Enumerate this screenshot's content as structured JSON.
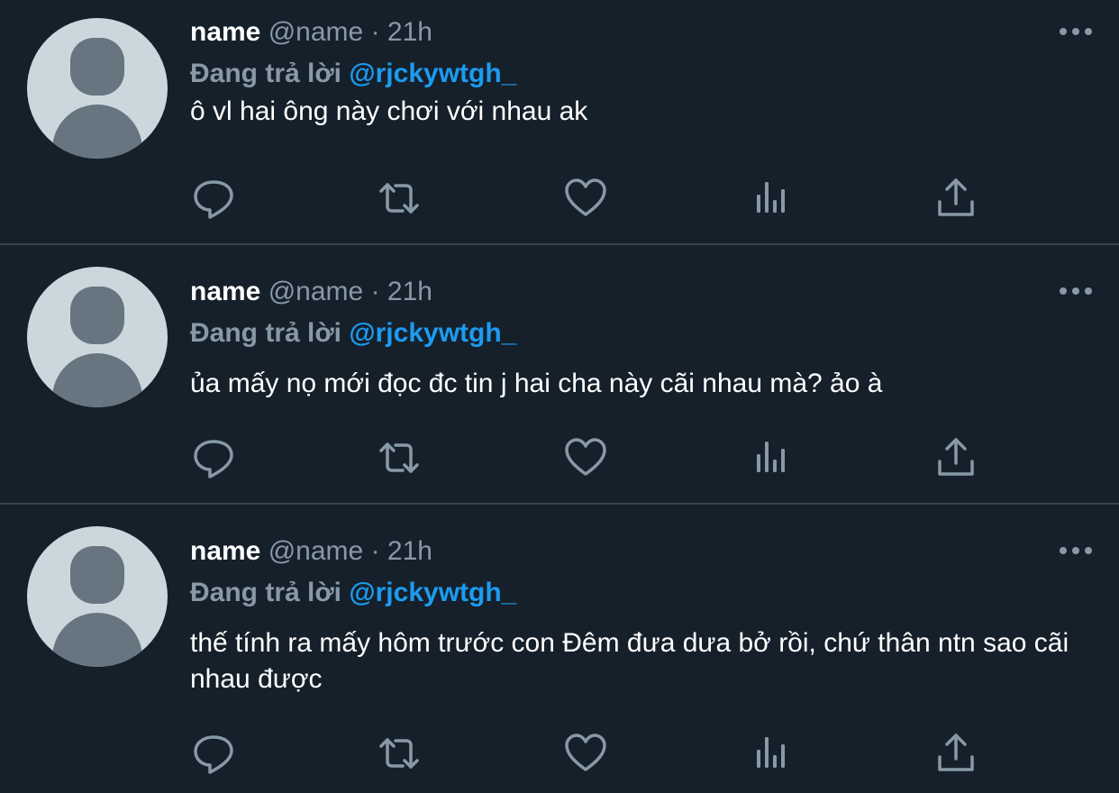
{
  "colors": {
    "background": "#15202b",
    "text": "#ffffff",
    "muted": "#8899a6",
    "link": "#1d9bf0",
    "divider": "#38444d",
    "icon": "#8899a6"
  },
  "tweets": [
    {
      "display_name": "name",
      "handle": "@name",
      "separator": "·",
      "time": "21h",
      "reply_prefix": "Đang trả lời",
      "reply_to": "@rjckywtgh_",
      "text": "ô vl hai ông này chơi với nhau ak"
    },
    {
      "display_name": "name",
      "handle": "@name",
      "separator": "·",
      "time": "21h",
      "reply_prefix": "Đang trả lời",
      "reply_to": "@rjckywtgh_",
      "text": "ủa mấy nọ mới đọc đc tin j hai cha này cãi nhau mà? ảo à"
    },
    {
      "display_name": "name",
      "handle": "@name",
      "separator": "·",
      "time": "21h",
      "reply_prefix": "Đang trả lời",
      "reply_to": "@rjckywtgh_",
      "text": "thế tính ra mấy hôm trước con Đêm đưa dưa bở rồi, chứ thân ntn sao cãi nhau được"
    }
  ],
  "icons": [
    "more-icon",
    "reply-icon",
    "retweet-icon",
    "like-icon",
    "views-icon",
    "share-icon"
  ]
}
